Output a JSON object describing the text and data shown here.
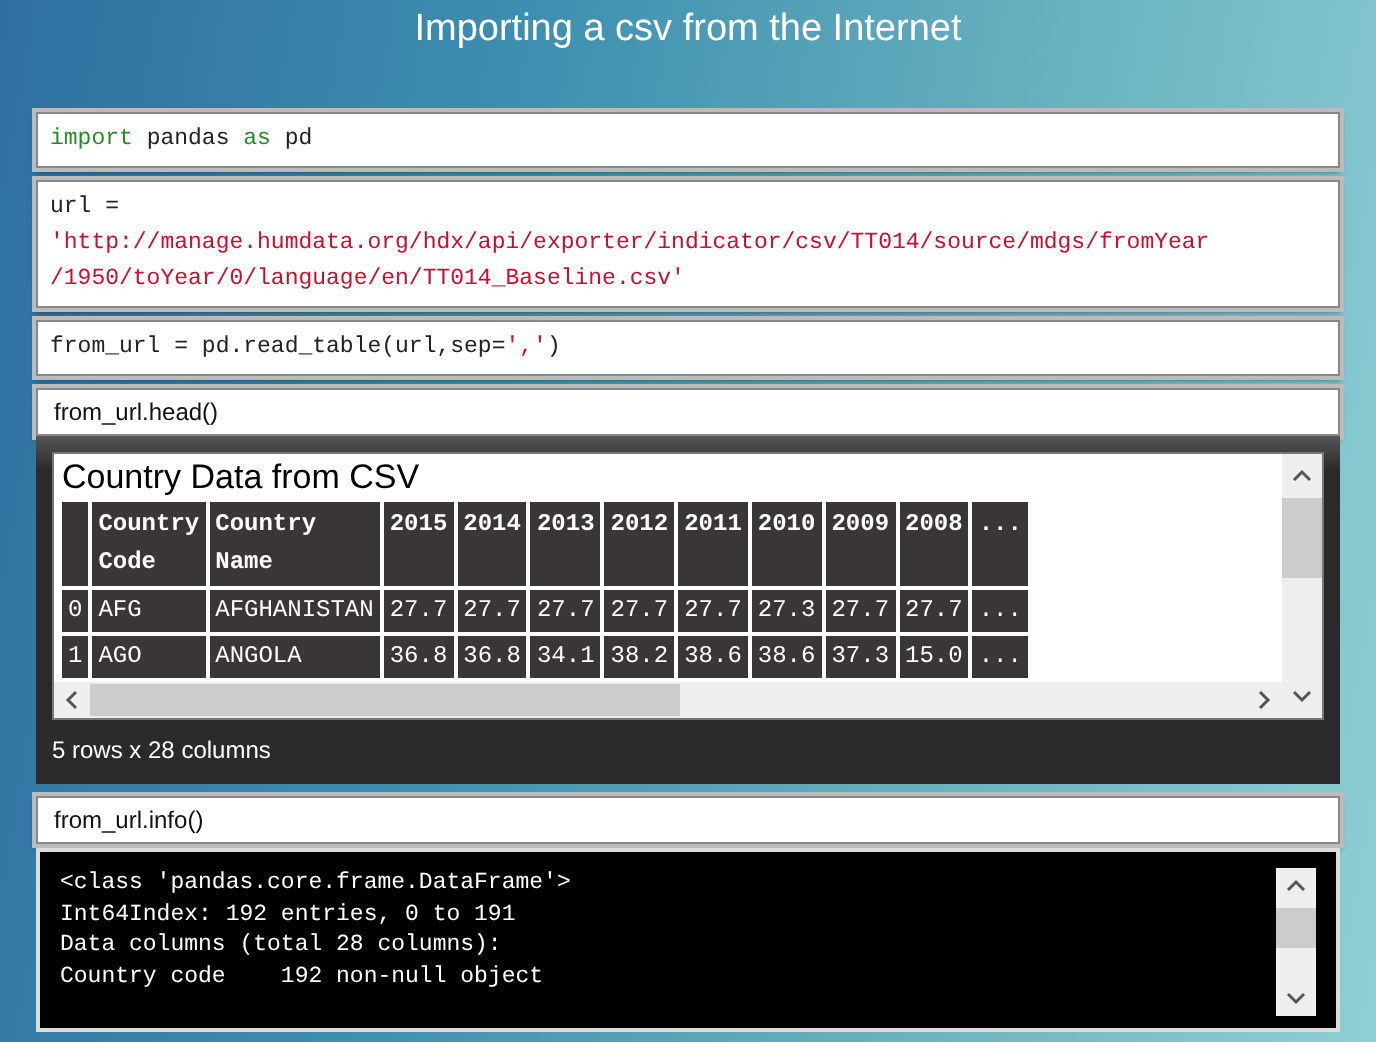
{
  "title": "Importing a csv from the Internet",
  "cells": [
    {
      "kind": "code",
      "lines": [
        [
          {
            "t": "import",
            "kind": "keyword"
          },
          {
            "t": " pandas ",
            "kind": "plain"
          },
          {
            "t": "as",
            "kind": "keyword"
          },
          {
            "t": " pd",
            "kind": "plain"
          }
        ]
      ]
    },
    {
      "kind": "code",
      "lines": [
        [
          {
            "t": "url =",
            "kind": "plain"
          }
        ],
        [
          {
            "t": "'http://manage.humdata.org/hdx/api/exporter/indicator/csv/TT014/source/mdgs/fromYear",
            "kind": "string"
          }
        ],
        [
          {
            "t": "/1950/toYear/0/language/en/TT014_Baseline.csv'",
            "kind": "string"
          }
        ]
      ]
    },
    {
      "kind": "code",
      "lines": [
        [
          {
            "t": "from_url = pd.read_table(url,sep=",
            "kind": "plain"
          },
          {
            "t": "','",
            "kind": "string"
          },
          {
            "t": ")",
            "kind": "plain"
          }
        ]
      ]
    },
    {
      "kind": "text",
      "text": "from_url.head()"
    },
    {
      "kind": "table",
      "title": "Country Data from CSV",
      "columns": [
        "",
        "Country Code",
        "Country Name",
        "2015",
        "2014",
        "2013",
        "2012",
        "2011",
        "2010",
        "2009",
        "2008",
        "..."
      ],
      "rows": [
        [
          "0",
          "AFG",
          "AFGHANISTAN",
          "27.7",
          "27.7",
          "27.7",
          "27.7",
          "27.7",
          "27.3",
          "27.7",
          "27.7",
          "..."
        ],
        [
          "1",
          "AGO",
          "ANGOLA",
          "36.8",
          "36.8",
          "34.1",
          "38.2",
          "38.6",
          "38.6",
          "37.3",
          "15.0",
          "..."
        ]
      ],
      "footer": "5 rows x 28 columns"
    },
    {
      "kind": "text",
      "text": "from_url.info()"
    },
    {
      "kind": "console",
      "lines": [
        "<class 'pandas.core.frame.DataFrame'>",
        "Int64Index: 192 entries, 0 to 191",
        "Data columns (total 28 columns):",
        "Country code    192 non-null object"
      ]
    }
  ]
}
